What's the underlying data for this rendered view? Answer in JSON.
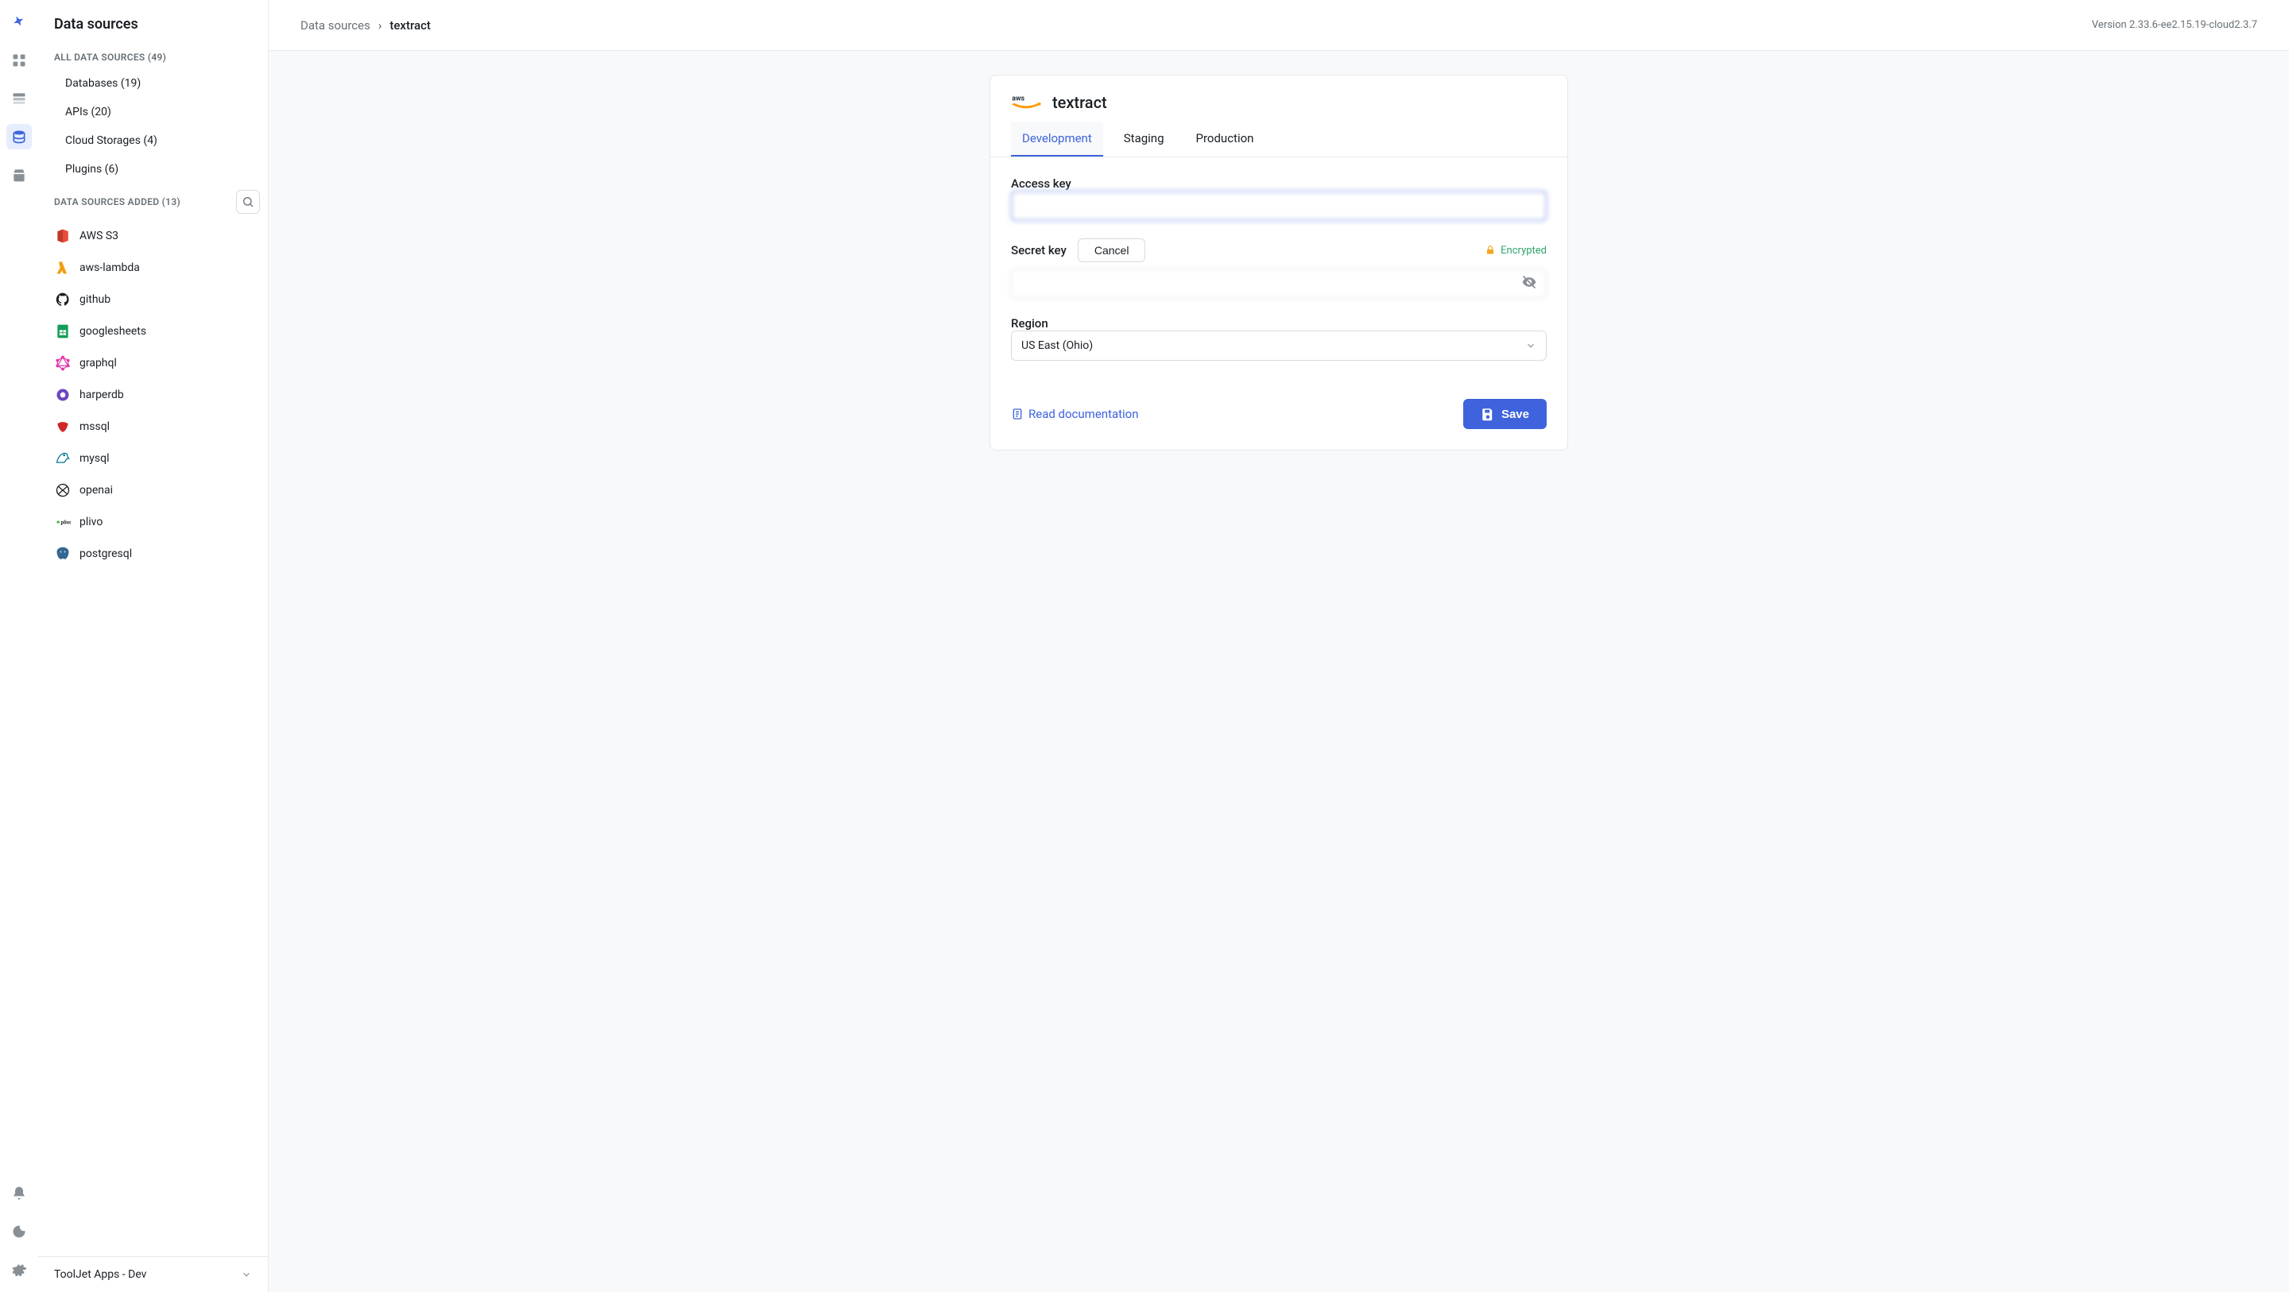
{
  "sidebar": {
    "title": "Data sources",
    "all_label": "ALL DATA SOURCES (49)",
    "categories": [
      {
        "label": "Databases (19)"
      },
      {
        "label": "APIs (20)"
      },
      {
        "label": "Cloud Storages (4)"
      },
      {
        "label": "Plugins (6)"
      }
    ],
    "added_label": "DATA SOURCES ADDED (13)",
    "items": [
      {
        "name": "AWS S3",
        "icon": "aws-s3"
      },
      {
        "name": "aws-lambda",
        "icon": "aws-lambda"
      },
      {
        "name": "github",
        "icon": "github"
      },
      {
        "name": "googlesheets",
        "icon": "googlesheets"
      },
      {
        "name": "graphql",
        "icon": "graphql"
      },
      {
        "name": "harperdb",
        "icon": "harperdb"
      },
      {
        "name": "mssql",
        "icon": "mssql"
      },
      {
        "name": "mysql",
        "icon": "mysql"
      },
      {
        "name": "openai",
        "icon": "openai"
      },
      {
        "name": "plivo",
        "icon": "plivo"
      },
      {
        "name": "postgresql",
        "icon": "postgresql"
      }
    ]
  },
  "footer": {
    "workspace": "ToolJet Apps - Dev"
  },
  "breadcrumb": {
    "root": "Data sources",
    "current": "textract"
  },
  "version": "Version 2.33.6-ee2.15.19-cloud2.3.7",
  "form": {
    "title": "textract",
    "tabs": [
      "Development",
      "Staging",
      "Production"
    ],
    "active_tab": "Development",
    "access_key_label": "Access key",
    "access_key_value": "",
    "secret_key_label": "Secret key",
    "secret_key_value": "",
    "cancel_label": "Cancel",
    "encrypted_label": "Encrypted",
    "region_label": "Region",
    "region_value": "US East (Ohio)",
    "doc_link": "Read documentation",
    "save_label": "Save"
  },
  "colors": {
    "accent": "#3e63dd",
    "success": "#30a46c"
  }
}
